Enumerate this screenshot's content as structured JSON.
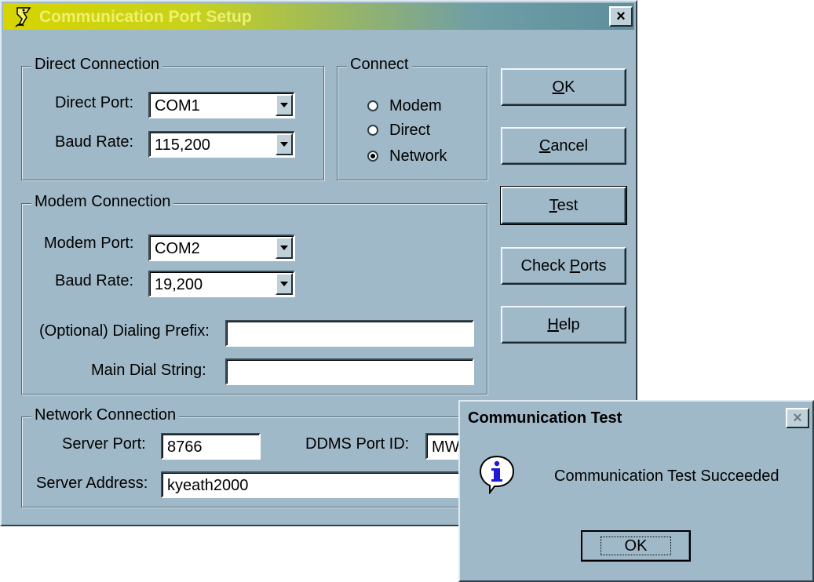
{
  "main_dialog": {
    "title": "Communication Port Setup",
    "close_label": "×",
    "direct": {
      "legend": "Direct Connection",
      "port_label": "Direct Port:",
      "port_value": "COM1",
      "baud_label": "Baud Rate:",
      "baud_value": "115,200"
    },
    "connect": {
      "legend": "Connect",
      "options": [
        "Modem",
        "Direct",
        "Network"
      ],
      "selected": "Network"
    },
    "modem": {
      "legend": "Modem Connection",
      "port_label": "Modem Port:",
      "port_value": "COM2",
      "baud_label": "Baud Rate:",
      "baud_value": "19,200",
      "prefix_label": "(Optional) Dialing Prefix:",
      "prefix_value": "",
      "dial_label": "Main Dial String:",
      "dial_value": ""
    },
    "network": {
      "legend": "Network Connection",
      "server_port_label": "Server Port:",
      "server_port_value": "8766",
      "ddms_label": "DDMS Port ID:",
      "ddms_value": "MW",
      "server_address_label": "Server Address:",
      "server_address_value": "kyeath2000"
    },
    "buttons": {
      "ok": {
        "mnemonic": "O",
        "rest": "K"
      },
      "cancel": {
        "mnemonic": "C",
        "rest": "ancel"
      },
      "test": {
        "mnemonic": "T",
        "rest": "est"
      },
      "check_ports": {
        "before": "Check ",
        "mnemonic": "P",
        "rest": "orts"
      },
      "help": {
        "mnemonic": "H",
        "rest": "elp"
      }
    }
  },
  "test_dialog": {
    "title": "Communication Test",
    "close_label": "×",
    "icon": "info-icon",
    "message": "Communication Test Succeeded",
    "ok_label": "OK"
  },
  "colors": {
    "face": "#a0b9c8",
    "title_gradient_start": "#d6d400",
    "title_gradient_end": "#5d8f9c",
    "title_text": "#eef070",
    "info_blue": "#1c1cd8"
  }
}
